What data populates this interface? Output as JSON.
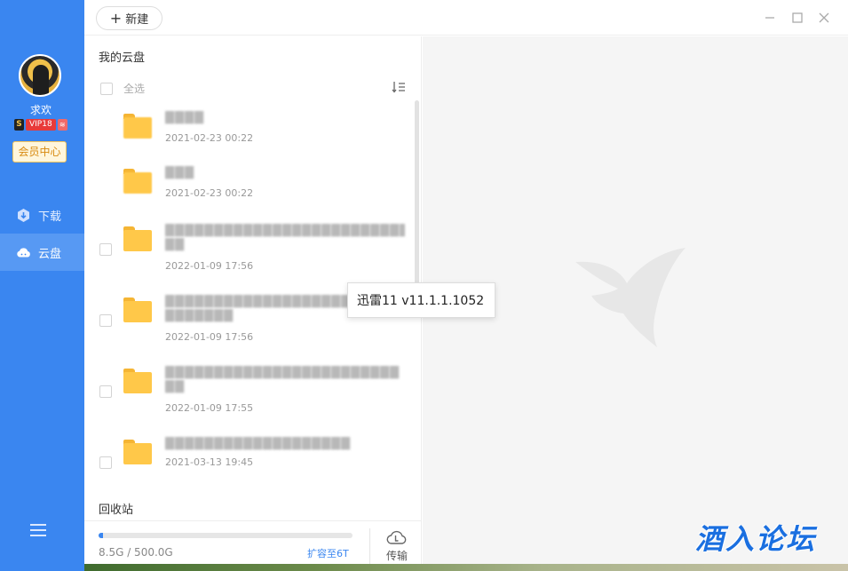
{
  "sidebar": {
    "username": "求欢",
    "badge_s": "S",
    "badge_vip": "VIP18",
    "badge_x": "≋",
    "member_center": "会员中心",
    "nav": [
      {
        "label": "下载",
        "icon": "download-icon",
        "active": false
      },
      {
        "label": "云盘",
        "icon": "cloud-icon",
        "active": true
      }
    ],
    "accent": "#3a86f0"
  },
  "toolbar": {
    "new_label": "新建"
  },
  "panel": {
    "title": "我的云盘",
    "select_all": "全选",
    "files": [
      {
        "name": "████",
        "date": "2021-02-23 00:22"
      },
      {
        "name": "███",
        "date": "2021-02-23 00:22"
      },
      {
        "name": "█████████████████████████",
        "name2": "██",
        "date": "2022-01-09 17:56"
      },
      {
        "name": "████████████████████",
        "name2": "███████",
        "date": "2022-01-09 17:56"
      },
      {
        "name": "████████████████████████",
        "name2": "██",
        "date": "2022-01-09 17:55"
      },
      {
        "name": "███████████████████",
        "date": "2021-03-13 19:45"
      }
    ],
    "recycle": "回收站",
    "storage": {
      "used_text": "8.5G / 500.0G",
      "used_fraction": 0.017,
      "expand": "扩容至6T",
      "transfer": "传输"
    }
  },
  "tooltip": {
    "text": "迅雷11 v11.1.1.1052"
  },
  "watermark": {
    "text": "酒入论坛"
  }
}
